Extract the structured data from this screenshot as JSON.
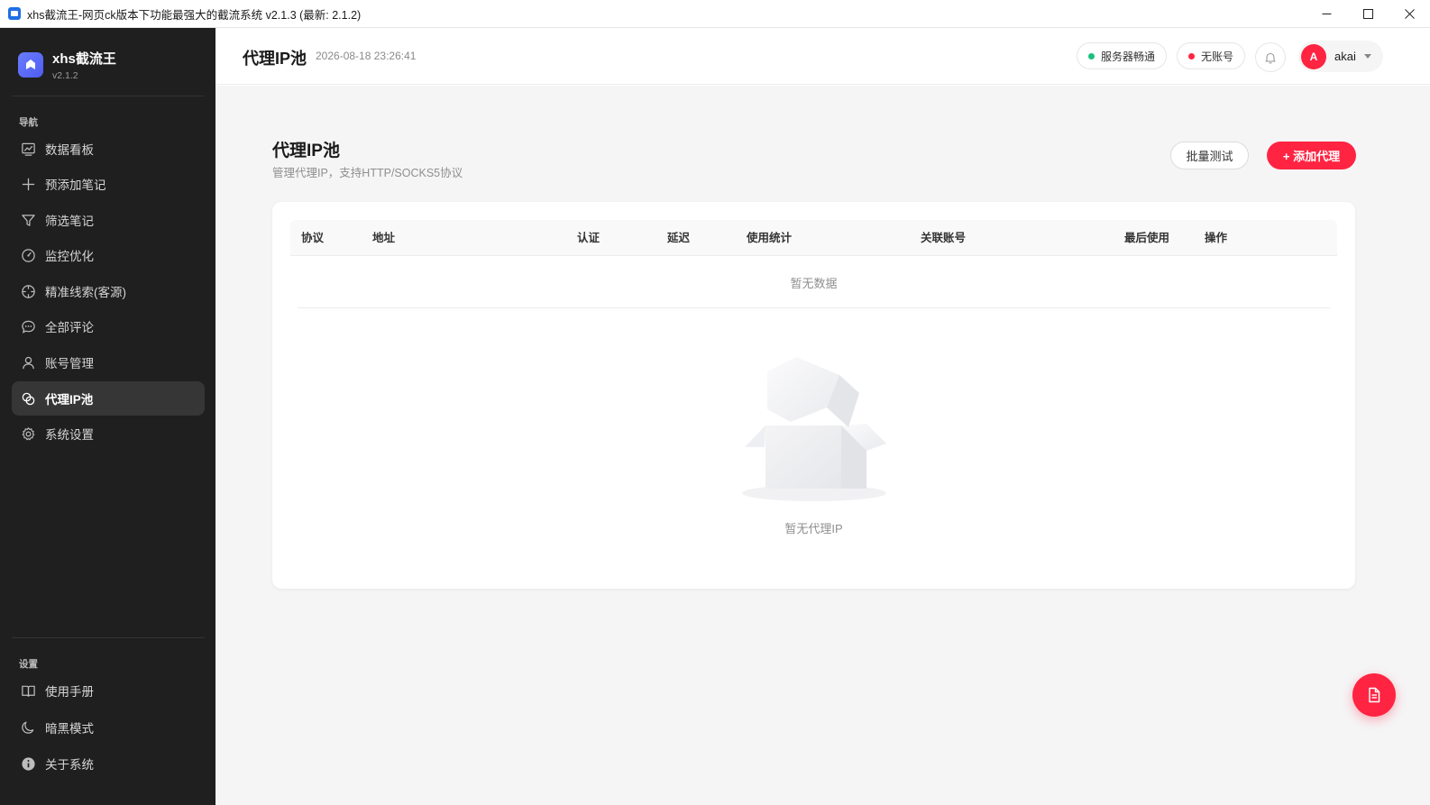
{
  "window": {
    "title": "xhs截流王-网页ck版本下功能最强大的截流系统 v2.1.3 (最新: 2.1.2)",
    "icon": "app-icon",
    "controls": [
      "minimize-icon",
      "maximize-icon",
      "close-icon"
    ]
  },
  "sidebar": {
    "brand_name": "xhs截流王",
    "brand_version": "v2.1.2",
    "nav_section": "导航",
    "nav_items": [
      {
        "label": "数据看板",
        "icon": "chart-icon"
      },
      {
        "label": "预添加笔记",
        "icon": "plus-icon"
      },
      {
        "label": "筛选笔记",
        "icon": "filter-icon"
      },
      {
        "label": "监控优化",
        "icon": "gauge-icon"
      },
      {
        "label": "精准线索(客源)",
        "icon": "target-icon"
      },
      {
        "label": "全部评论",
        "icon": "comment-icon"
      },
      {
        "label": "账号管理",
        "icon": "user-icon"
      },
      {
        "label": "代理IP池",
        "icon": "proxy-icon",
        "active": true
      },
      {
        "label": "系统设置",
        "icon": "gear-icon"
      }
    ],
    "settings_section": "设置",
    "settings_items": [
      {
        "label": "使用手册",
        "icon": "book-icon"
      },
      {
        "label": "暗黑模式",
        "icon": "moon-icon"
      },
      {
        "label": "关于系统",
        "icon": "info-icon"
      }
    ]
  },
  "header": {
    "title": "代理IP池",
    "datetime": "2026-08-18 23:26:41",
    "server_status": "服务器畅通",
    "server_status_color": "#18c07a",
    "account_status": "无账号",
    "account_status_color": "#ff2442",
    "user_initial": "A",
    "user_name": "akai"
  },
  "main": {
    "title": "代理IP池",
    "subtitle": "管理代理IP，支持HTTP/SOCKS5协议",
    "batch_test_label": "批量测试",
    "add_proxy_label": "+ 添加代理",
    "table": {
      "columns": [
        "协议",
        "地址",
        "认证",
        "延迟",
        "使用统计",
        "关联账号",
        "最后使用",
        "操作"
      ],
      "empty_text": "暂无数据"
    },
    "empty_state_text": "暂无代理IP"
  },
  "colors": {
    "accent": "#ff2442",
    "sidebar_bg": "#1f1f1f",
    "main_bg": "#f5f5f6"
  }
}
